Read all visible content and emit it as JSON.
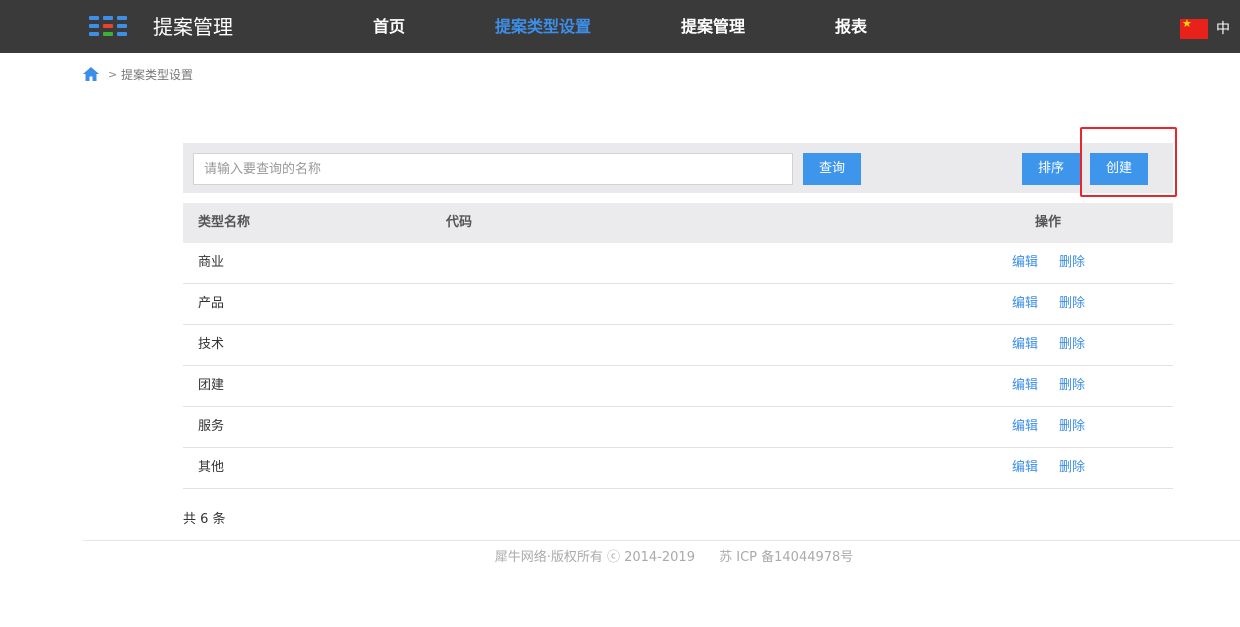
{
  "header": {
    "app_title": "提案管理",
    "nav": [
      "首页",
      "提案类型设置",
      "提案管理",
      "报表"
    ],
    "active_nav": "提案类型设置",
    "language": "中",
    "flag_icon": "china-flag-icon"
  },
  "breadcrumb": {
    "separator": ">",
    "current": "提案类型设置"
  },
  "toolbar": {
    "search_placeholder": "请输入要查询的名称",
    "search_value": "",
    "query_label": "查询",
    "sort_label": "排序",
    "create_label": "创建"
  },
  "table": {
    "headers": {
      "name": "类型名称",
      "code": "代码",
      "actions": "操作"
    },
    "rows": [
      {
        "name": "商业",
        "code": ""
      },
      {
        "name": "产品",
        "code": ""
      },
      {
        "name": "技术",
        "code": ""
      },
      {
        "name": "团建",
        "code": ""
      },
      {
        "name": "服务",
        "code": ""
      },
      {
        "name": "其他",
        "code": ""
      }
    ],
    "edit_label": "编辑",
    "delete_label": "删除"
  },
  "pagination": {
    "total_text": "共 6 条"
  },
  "footer": {
    "copyright": "犀牛网络·版权所有 ⓒ 2014-2019",
    "icp": "苏 ICP 备14044978号"
  },
  "colors": {
    "accent": "#3d95ec",
    "header_bg": "#3a3a3a",
    "highlight": "#e8262b"
  }
}
